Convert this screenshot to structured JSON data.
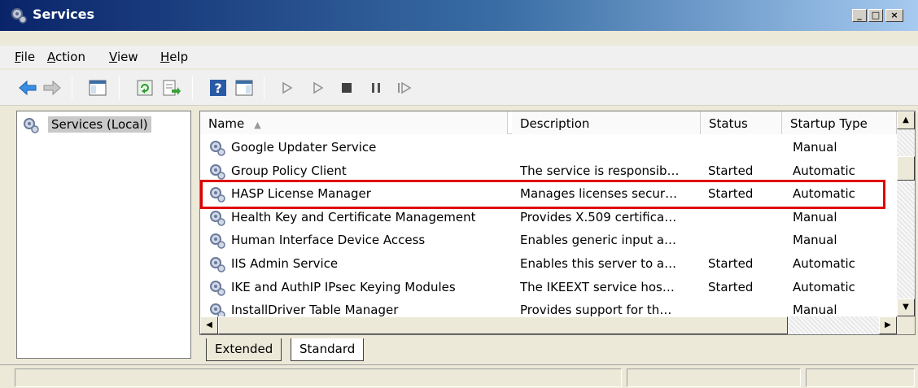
{
  "window": {
    "title": "Services"
  },
  "menu": [
    {
      "label": "File",
      "accel": "F"
    },
    {
      "label": "Action",
      "accel": "A"
    },
    {
      "label": "View",
      "accel": "V"
    },
    {
      "label": "Help",
      "accel": "H"
    }
  ],
  "tree": {
    "root_label": "Services (Local)"
  },
  "table": {
    "headers": [
      "Name",
      "Description",
      "Status",
      "Startup Type"
    ],
    "sort_indicator": "▲",
    "rows": [
      {
        "name": "Google Updater Service",
        "description": "",
        "status": "",
        "startup": "Manual"
      },
      {
        "name": "Group Policy Client",
        "description": "The service is responsib…",
        "status": "Started",
        "startup": "Automatic"
      },
      {
        "name": "HASP License Manager",
        "description": "Manages licenses secur…",
        "status": "Started",
        "startup": "Automatic"
      },
      {
        "name": "Health Key and Certificate Management",
        "description": "Provides X.509 certifica…",
        "status": "",
        "startup": "Manual"
      },
      {
        "name": "Human Interface Device Access",
        "description": "Enables generic input a…",
        "status": "",
        "startup": "Manual"
      },
      {
        "name": "IIS Admin Service",
        "description": "Enables this server to a…",
        "status": "Started",
        "startup": "Automatic"
      },
      {
        "name": "IKE and AuthIP IPsec Keying Modules",
        "description": "The IKEEXT service hos…",
        "status": "Started",
        "startup": "Automatic"
      },
      {
        "name": "InstallDriver Table Manager",
        "description": "Provides support for th…",
        "status": "",
        "startup": "Manual"
      }
    ]
  },
  "tabs": [
    {
      "label": "Extended"
    },
    {
      "label": "Standard"
    }
  ],
  "colors": {
    "highlight_border": "#e00000",
    "title_gradient_start": "#0a246a",
    "title_gradient_end": "#a6caf0"
  },
  "icons": [
    "gear-icon",
    "back-arrow-icon",
    "forward-arrow-icon",
    "console-tree-icon",
    "refresh-icon",
    "export-list-icon",
    "help-icon",
    "properties-icon",
    "play-icon",
    "play-alt-icon",
    "stop-icon",
    "pause-icon",
    "resume-icon"
  ]
}
